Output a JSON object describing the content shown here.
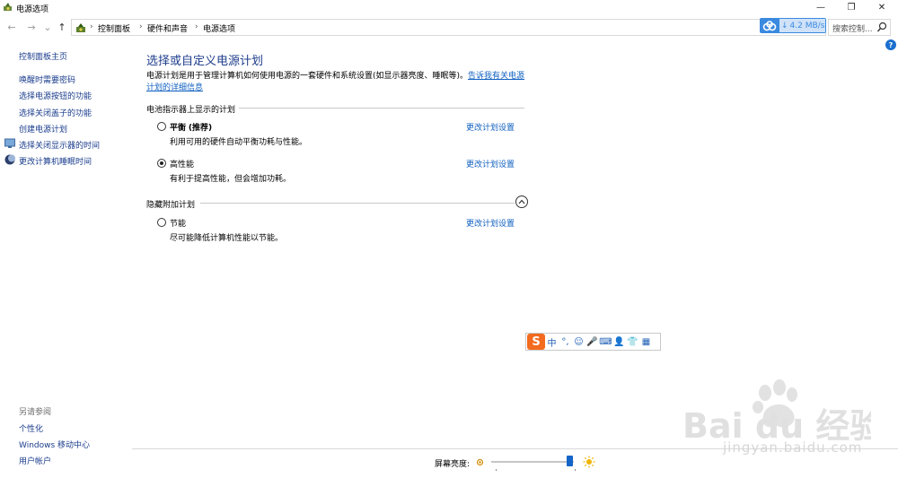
{
  "window": {
    "title": "电源选项",
    "buttons": [
      "—",
      "❐",
      "✕"
    ]
  },
  "address": {
    "nav": [
      "←",
      "→",
      "⌄",
      "↑"
    ],
    "crumbs": [
      "控制面板",
      "硬件和声音",
      "电源选项"
    ],
    "separator": "›",
    "speed": "4.2 MB/s",
    "search_placeholder": "搜索控制..."
  },
  "sidebar": {
    "home": "控制面板主页",
    "links": [
      {
        "label": "唤醒时需要密码"
      },
      {
        "label": "选择电源按钮的功能"
      },
      {
        "label": "选择关闭盖子的功能"
      },
      {
        "label": "创建电源计划"
      },
      {
        "label": "选择关闭显示器的时间"
      },
      {
        "label": "更改计算机睡眠时间"
      }
    ],
    "see_also": "另请参阅",
    "see_also_links": [
      "个性化",
      "Windows 移动中心",
      "用户帐户"
    ]
  },
  "main": {
    "title": "选择或自定义电源计划",
    "desc_text": "电源计划是用于管理计算机如何使用电源的一套硬件和系统设置(如显示器亮度、睡眠等)。",
    "desc_link": "告诉我有关电源计划的详细信息",
    "battery_section": "电池指示器上显示的计划",
    "hidden_section": "隐藏附加计划",
    "change_link": "更改计划设置",
    "plans": [
      {
        "name": "平衡",
        "tag": "(推荐)",
        "desc": "利用可用的硬件自动平衡功耗与性能。",
        "selected": false
      },
      {
        "name": "高性能",
        "tag": "",
        "desc": "有利于提高性能，但会增加功耗。",
        "selected": true
      },
      {
        "name": "节能",
        "tag": "",
        "desc": "尽可能降低计算机性能以节能。",
        "selected": false
      }
    ]
  },
  "ime": {
    "logo": "S",
    "items": [
      "中",
      "°,",
      "☺",
      "🎤",
      "⌨",
      "👤",
      "👕",
      "▦"
    ]
  },
  "brightness": {
    "label": "屏幕亮度:",
    "value": 0.99
  },
  "watermark": {
    "brand": "Bai du 经验",
    "site": "jingyan.baidu.com"
  },
  "colors": {
    "link": "#1060c0",
    "nav_link": "#1a3c8c",
    "title": "#1e3d8c",
    "accent": "#3a8ae0",
    "ime_logo": "#f26b1f"
  }
}
